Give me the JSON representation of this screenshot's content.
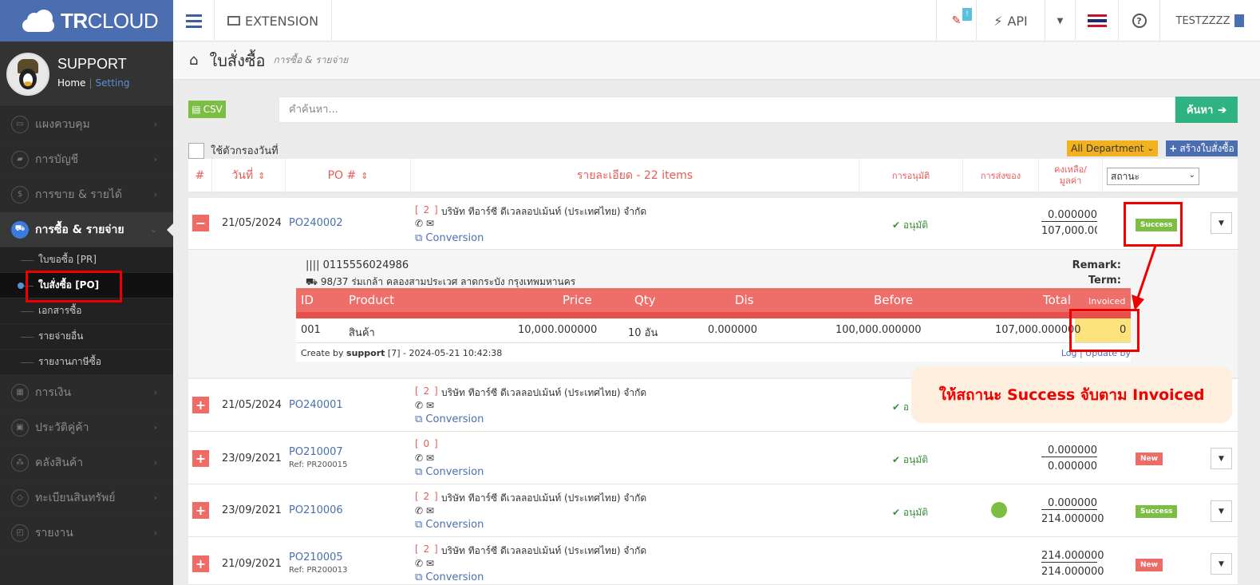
{
  "brand": {
    "name_bold": "TR",
    "name_rest": "CLOUD"
  },
  "profile": {
    "name": "SUPPORT",
    "home": "Home",
    "sep": "|",
    "setting": "Setting"
  },
  "menu": [
    {
      "label": "แผงควบคุม",
      "icon": "monitor-icon"
    },
    {
      "label": "การบัญชี",
      "icon": "book-icon"
    },
    {
      "label": "การขาย & รายได้",
      "icon": "dollar-icon"
    },
    {
      "label": "การซื้อ & รายจ่าย",
      "icon": "cart-icon",
      "active": true
    },
    {
      "label": "การเงิน",
      "icon": "calendar-icon"
    },
    {
      "label": "ประวัติคู่ค้า",
      "icon": "contact-icon"
    },
    {
      "label": "คลังสินค้า",
      "icon": "boxes-icon"
    },
    {
      "label": "ทะเบียนสินทรัพย์",
      "icon": "diamond-icon"
    },
    {
      "label": "รายงาน",
      "icon": "report-icon"
    }
  ],
  "submenu": [
    {
      "label": "ใบขอซื้อ [PR]"
    },
    {
      "label": "ใบสั่งซื้อ [PO]",
      "active": true
    },
    {
      "label": "เอกสารซื้อ"
    },
    {
      "label": "รายจ่ายอื่น"
    },
    {
      "label": "รายงานภาษีซื้อ"
    }
  ],
  "topnav": {
    "extension": "EXTENSION",
    "api": "API",
    "badge": "!",
    "user": "TESTZZZZ"
  },
  "page": {
    "title": "ใบสั่งซื้อ",
    "subtitle": "การซื้อ & รายจ่าย"
  },
  "toolbar": {
    "csv": "CSV",
    "search_placeholder": "คำค้นหา...",
    "search_btn": "ค้นหา",
    "date_filter": "ใช้ตัวกรองวันที่",
    "department": "All Department",
    "create": "สร้างใบสั่งซื้อ"
  },
  "table": {
    "headers": {
      "no": "#",
      "date": "วันที่",
      "po": "PO #",
      "detail": "รายละเอียด - 22 items",
      "approve": "การอนุมัติ",
      "delivery": "การส่งของ",
      "remain_1": "คงเหลือ/",
      "remain_2": "มูลค่า",
      "status": "สถานะ"
    },
    "rows": [
      {
        "toggle": "−",
        "date": "21/05/2024",
        "po": "PO240002",
        "ref": "",
        "count": "[ 2 ]",
        "vendor": "บริษัท ทีอาร์ซี ดีเวลลอปเม้นท์ (ประเทศไทย) จำกัด",
        "icons": "✆  ✉",
        "conversion": "Conversion",
        "approval": "อนุมัติ",
        "amount_top": "0.000000",
        "amount_bottom": "107,000.0000",
        "status": "Success"
      },
      {
        "toggle": "+",
        "date": "21/05/2024",
        "po": "PO240001",
        "ref": "",
        "count": "[ 2 ]",
        "vendor": "บริษัท ทีอาร์ซี ดีเวลลอปเม้นท์ (ประเทศไทย) จำกัด",
        "icons": "✆  ✉",
        "conversion": "Conversion",
        "approval": "อ",
        "amount_top": "",
        "amount_bottom": "",
        "status": ""
      },
      {
        "toggle": "+",
        "date": "23/09/2021",
        "po": "PO210007",
        "ref": "Ref: PR200015",
        "count": "[ 0 ]",
        "vendor": "",
        "icons": "✆  ✉",
        "conversion": "Conversion",
        "approval": "อนุมัติ",
        "amount_top": "0.000000",
        "amount_bottom": "0.000000",
        "status": "New"
      },
      {
        "toggle": "+",
        "date": "23/09/2021",
        "po": "PO210006",
        "ref": "",
        "count": "[ 2 ]",
        "vendor": "บริษัท ทีอาร์ซี ดีเวลลอปเม้นท์ (ประเทศไทย) จำกัด",
        "icons": "✆  ✉",
        "conversion": "Conversion",
        "approval": "อนุมัติ",
        "amount_top": "0.000000",
        "amount_bottom": "214.000000",
        "status": "Success"
      },
      {
        "toggle": "+",
        "date": "21/09/2021",
        "po": "PO210005",
        "ref": "Ref: PR200013",
        "count": "[ 2 ]",
        "vendor": "บริษัท ทีอาร์ซี ดีเวลลอปเม้นท์ (ประเทศไทย) จำกัด",
        "icons": "✆  ✉",
        "conversion": "Conversion",
        "approval": "",
        "amount_top": "214.000000",
        "amount_bottom": "214.000000",
        "status": "New"
      }
    ]
  },
  "detail": {
    "tax_id": "0115556024986",
    "address": "98/37 ร่มเกล้า คลองสามประเวศ ลาดกระบัง กรุงเทพมหานคร",
    "remark": "Remark:",
    "term": "Term:",
    "headers": {
      "id": "ID",
      "product": "Product",
      "price": "Price",
      "qty": "Qty",
      "dis": "Dis",
      "before": "Before",
      "total": "Total",
      "invoiced": "Invoiced"
    },
    "item": {
      "id": "001",
      "product": "สินค้า",
      "price": "10,000.000000",
      "qty": "10 อัน",
      "dis": "0.000000",
      "before": "100,000.000000",
      "total": "107,000.000000",
      "invoiced": "0"
    },
    "created_prefix": "Create by",
    "created_user": "support",
    "created_suffix": "[7] - 2024-05-21 10:42:38",
    "log": "Log | Update by"
  },
  "annotation": {
    "callout": "ให้สถานะ Success จับตาม Invoiced"
  },
  "colors": {
    "brand": "#4a6eb0",
    "accent_red": "#ef6b66",
    "success": "#7cbe44",
    "search_btn": "#30b383",
    "annotation": "#e00000"
  }
}
